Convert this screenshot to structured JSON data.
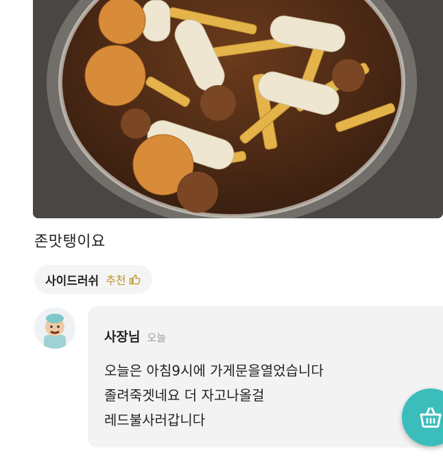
{
  "review": {
    "text": "존맛탱이요",
    "menu_chip": {
      "name": "사이드러쉬",
      "recommend_label": "추천",
      "icon": "thumbs-up-icon"
    }
  },
  "owner_reply": {
    "avatar_icon": "owner-avatar",
    "name": "사장님",
    "time": "오늘",
    "lines": [
      "오늘은 아침9시에 가게문을열었습니다",
      "졸려죽겟네요 더 자고나올걸",
      "레드불사러갑니다"
    ]
  },
  "floating_button": {
    "icon": "shopping-basket-icon",
    "color": "#3bbdbb"
  },
  "colors": {
    "recommend": "#c1932c",
    "reply_background": "#f3f3f3",
    "chip_background": "#f4f4f4"
  }
}
